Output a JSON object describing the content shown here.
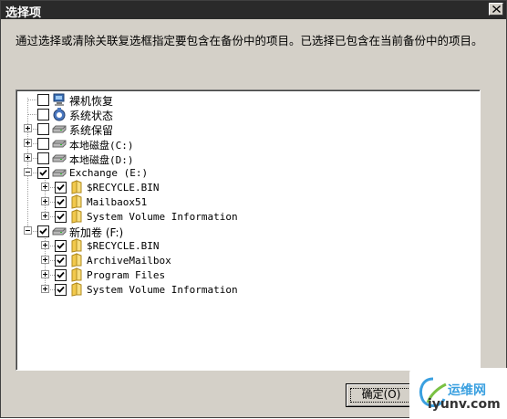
{
  "window": {
    "title": "选择项",
    "instruction": "通过选择或清除关联复选框指定要包含在备份中的项目。已选择已包含在当前备份中的项目。"
  },
  "tree": {
    "items": [
      {
        "label": "裸机恢复",
        "checked": false,
        "icon": "computer-icon"
      },
      {
        "label": "系统状态",
        "checked": false,
        "icon": "system-state-icon"
      },
      {
        "label": "系统保留",
        "checked": false,
        "icon": "drive-icon"
      },
      {
        "label": "本地磁盘(C:)",
        "checked": false,
        "icon": "drive-icon"
      },
      {
        "label": "本地磁盘(D:)",
        "checked": false,
        "icon": "drive-icon"
      },
      {
        "label": "Exchange (E:)",
        "checked": true,
        "icon": "drive-icon"
      },
      {
        "label": "$RECYCLE.BIN",
        "checked": true,
        "icon": "folder-icon"
      },
      {
        "label": "Mailbaox51",
        "checked": true,
        "icon": "folder-icon"
      },
      {
        "label": "System Volume Information",
        "checked": true,
        "icon": "folder-icon"
      },
      {
        "label": "新加卷 (F:)",
        "checked": true,
        "icon": "drive-icon"
      },
      {
        "label": "$RECYCLE.BIN",
        "checked": true,
        "icon": "folder-icon"
      },
      {
        "label": "ArchiveMailbox",
        "checked": true,
        "icon": "folder-icon"
      },
      {
        "label": "Program Files",
        "checked": true,
        "icon": "folder-icon"
      },
      {
        "label": "System Volume Information",
        "checked": true,
        "icon": "folder-icon"
      }
    ]
  },
  "buttons": {
    "ok_label": "确定(O)"
  },
  "watermark": {
    "top": "运维网",
    "bottom": "iyunv.com"
  },
  "colors": {
    "titlebar": "#2a2a2a",
    "dialog_bg": "#d4d0c8",
    "folder": "#f2c94c",
    "watermark_accent": "#3aa0e0"
  }
}
